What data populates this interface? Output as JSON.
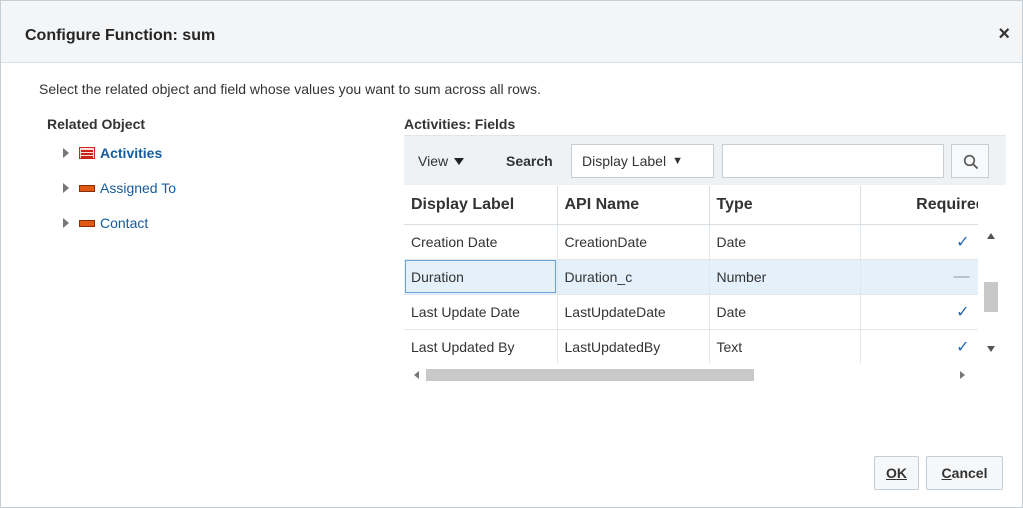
{
  "dialog": {
    "title": "Configure Function: sum",
    "close_glyph": "×",
    "instructions": "Select the related object and field whose values you want to sum across all rows."
  },
  "related_objects": {
    "heading": "Related Object",
    "items": [
      {
        "label": "Activities",
        "icon": "list-object-icon",
        "selected": true
      },
      {
        "label": "Assigned To",
        "icon": "object-icon",
        "selected": false
      },
      {
        "label": "Contact",
        "icon": "object-icon",
        "selected": false
      }
    ]
  },
  "fields": {
    "heading": "Activities: Fields",
    "toolbar": {
      "view_label": "View",
      "search_label": "Search",
      "search_by": "Display Label",
      "search_value": "",
      "search_icon": "magnifier-icon"
    },
    "columns": [
      "Display Label",
      "API Name",
      "Type",
      "Required"
    ],
    "rows": [
      {
        "display_label": "Creation Date",
        "api_name": "CreationDate",
        "type": "Date",
        "required": "✓"
      },
      {
        "display_label": "Duration",
        "api_name": "Duration_c",
        "type": "Number",
        "required": "—"
      },
      {
        "display_label": "Last Update Date",
        "api_name": "LastUpdateDate",
        "type": "Date",
        "required": "✓"
      },
      {
        "display_label": "Last Updated By",
        "api_name": "LastUpdatedBy",
        "type": "Text",
        "required": "✓"
      }
    ],
    "selected_row": 1
  },
  "buttons": {
    "ok_mnemonic": "K",
    "ok_prefix": "O",
    "cancel_mnemonic": "C",
    "cancel_rest": "ancel"
  },
  "colors": {
    "link": "#145c9e",
    "selected_row_bg": "#e4f0fa",
    "check": "#2267b2",
    "title_bar": "#f3f5f7"
  }
}
